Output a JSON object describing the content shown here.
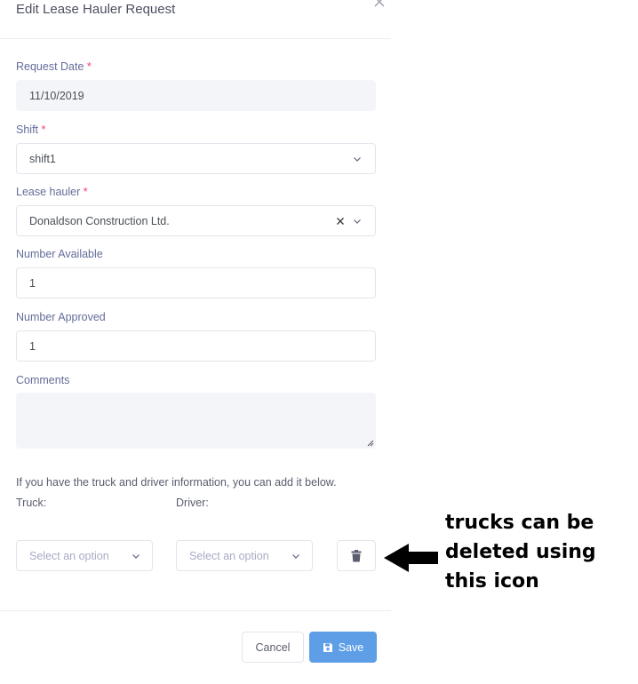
{
  "modal": {
    "title": "Edit Lease Hauler Request"
  },
  "form": {
    "request_date": {
      "label": "Request Date",
      "required_mark": "*",
      "value": "11/10/2019"
    },
    "shift": {
      "label": "Shift",
      "required_mark": "*",
      "value": "shift1"
    },
    "lease_hauler": {
      "label": "Lease hauler",
      "required_mark": "*",
      "value": "Donaldson Construction Ltd."
    },
    "number_available": {
      "label": "Number Available",
      "value": "1"
    },
    "number_approved": {
      "label": "Number Approved",
      "value": "1"
    },
    "comments": {
      "label": "Comments",
      "value": ""
    }
  },
  "trucks": {
    "hint": "If you have the truck and driver information, you can add it below.",
    "truck_label": "Truck:",
    "driver_label": "Driver:",
    "truck_placeholder": "Select an option",
    "driver_placeholder": "Select an option"
  },
  "footer": {
    "cancel_label": "Cancel",
    "save_label": "Save"
  },
  "annotation": {
    "text": "trucks can be\ndeleted using\nthis icon"
  },
  "icons": [
    "close-icon",
    "chevron-down-icon",
    "clear-icon",
    "trash-icon",
    "save-icon",
    "arrow-left-icon"
  ],
  "colors": {
    "required": "#fd397a",
    "save_button": "#5d9ee6",
    "readonly_field": "#f4f5f8"
  }
}
